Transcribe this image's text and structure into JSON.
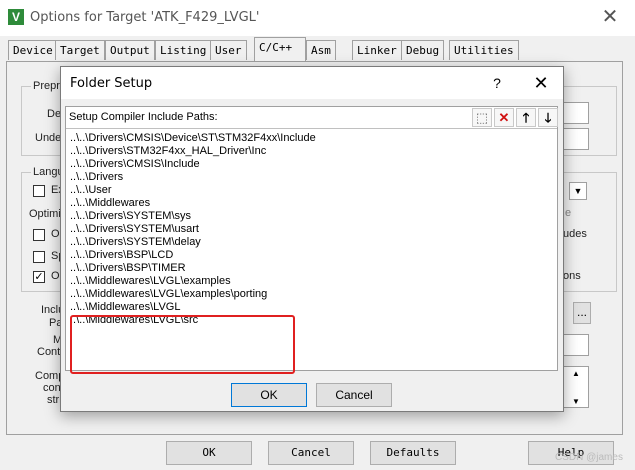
{
  "outer_window": {
    "icon_letter": "V",
    "title": "Options for Target 'ATK_F429_LVGL'",
    "close_glyph": "✕",
    "tabs": [
      "Device",
      "Target",
      "Output",
      "Listing",
      "User",
      "C/C++",
      "Asm",
      "Linker",
      "Debug",
      "Utilities"
    ],
    "active_tab": "C/C++",
    "partial_labels": {
      "preprocessor_group": "Prepro",
      "define": "Def",
      "undefine": "Undel",
      "language_group": "Langu",
      "execute_only": "Ex",
      "optimization": "Optimiz",
      "option1": "Op",
      "option2": "Sp",
      "option3": "On",
      "include": "Inclu",
      "paths": "Pa",
      "misc": "M",
      "controls": "Contr",
      "compiler": "Comp",
      "control": "cont",
      "string": "stri",
      "right_ude": "udes",
      "right_ons": "ons",
      "right_e": "e"
    },
    "ellipsis_button": "...",
    "buttons": {
      "ok": "OK",
      "cancel": "Cancel",
      "defaults": "Defaults",
      "help": "Help"
    }
  },
  "dialog": {
    "title": "Folder Setup",
    "help_glyph": "?",
    "close_glyph": "✕",
    "list_header": "Setup Compiler Include Paths:",
    "toolbar": {
      "new_glyph": "⬚",
      "delete_glyph": "✕",
      "up_glyph": "🡑",
      "down_glyph": "🡓"
    },
    "paths": [
      "..\\..\\Drivers\\CMSIS\\Device\\ST\\STM32F4xx\\Include",
      "..\\..\\Drivers\\STM32F4xx_HAL_Driver\\Inc",
      "..\\..\\Drivers\\CMSIS\\Include",
      "..\\..\\Drivers",
      "..\\..\\User",
      "..\\..\\Middlewares",
      "..\\..\\Drivers\\SYSTEM\\sys",
      "..\\..\\Drivers\\SYSTEM\\usart",
      "..\\..\\Drivers\\SYSTEM\\delay",
      "..\\..\\Drivers\\BSP\\LCD",
      "..\\..\\Drivers\\BSP\\TIMER",
      "..\\..\\Middlewares\\LVGL\\examples",
      "..\\..\\Middlewares\\LVGL\\examples\\porting",
      "..\\..\\Middlewares\\LVGL",
      "..\\..\\Middlewares\\LVGL\\src"
    ],
    "buttons": {
      "ok": "OK",
      "cancel": "Cancel"
    },
    "highlight_color": "#e02020"
  },
  "watermark": "CSDN @james"
}
